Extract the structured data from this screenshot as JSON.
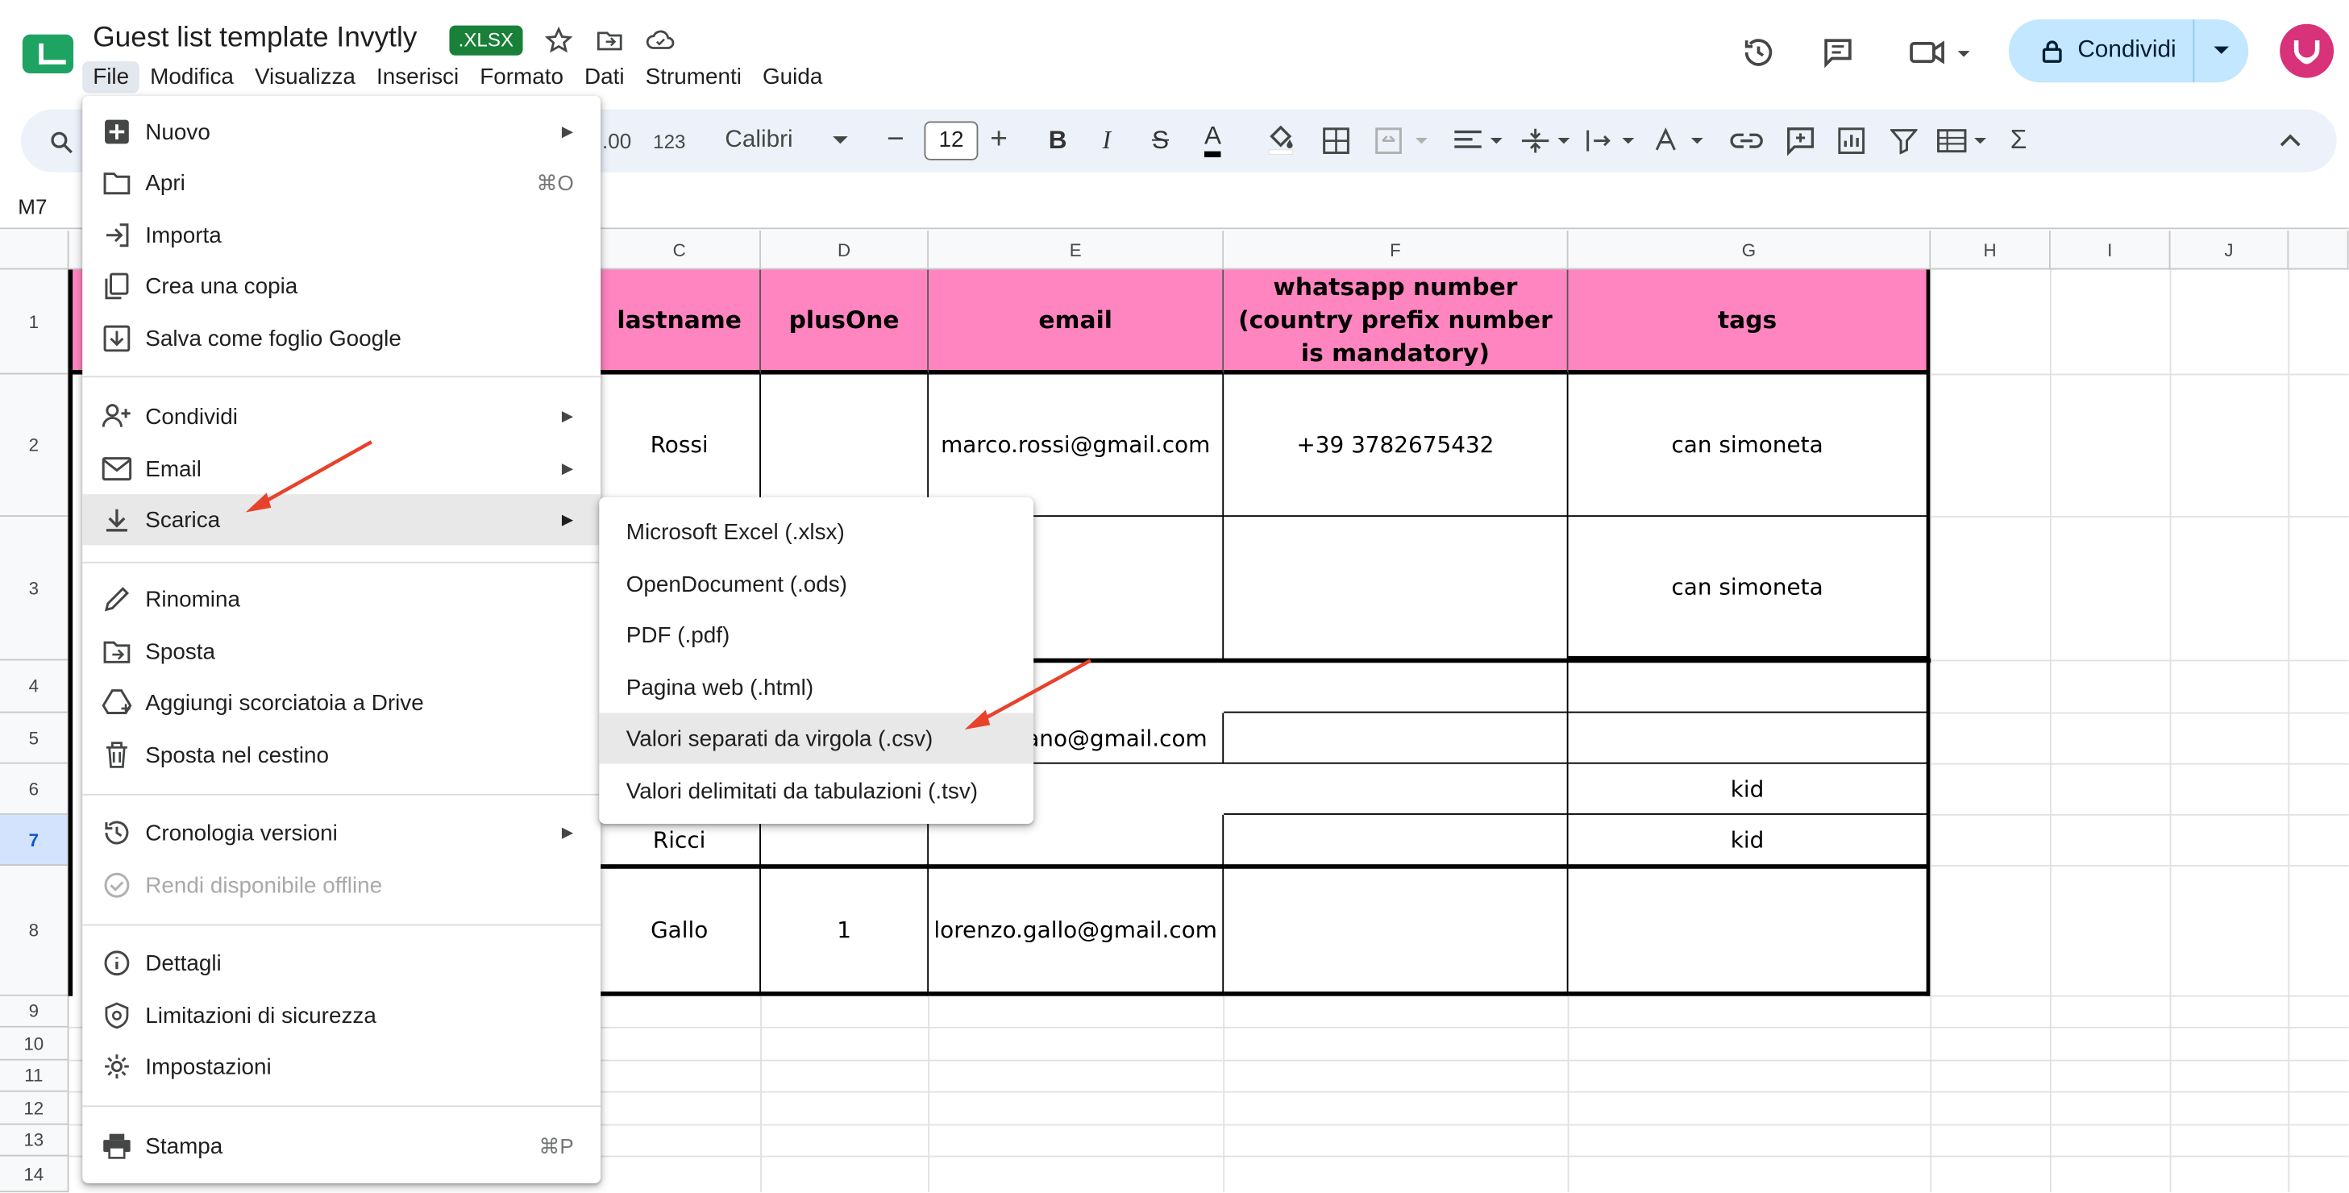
{
  "document": {
    "title": "Guest list template Invytly",
    "format_badge": ".XLSX"
  },
  "menubar": [
    "File",
    "Modifica",
    "Visualizza",
    "Inserisci",
    "Formato",
    "Dati",
    "Strumenti",
    "Guida"
  ],
  "share": {
    "label": "Condividi"
  },
  "toolbar": {
    "number_decimals": ".00",
    "number_format": "123",
    "font_family": "Calibri",
    "font_size": "12",
    "minus": "−",
    "plus": "+",
    "bold": "B",
    "italic": "I",
    "strike": "S",
    "text_color": "A",
    "sum": "Σ"
  },
  "name_box": "M7",
  "columns": [
    "C",
    "D",
    "E",
    "F",
    "G",
    "H",
    "I",
    "J"
  ],
  "rows": [
    "1",
    "2",
    "3",
    "4",
    "5",
    "6",
    "7",
    "8",
    "9",
    "10",
    "11",
    "12",
    "13",
    "14"
  ],
  "header_row": {
    "lastname": "lastname",
    "plusOne": "plusOne",
    "email": "email",
    "whatsapp": "whatsapp number (country prefix number is mandatory)",
    "tags": "tags"
  },
  "cells": {
    "r2_lastname": "Rossi",
    "r2_email": "marco.rossi@gmail.com",
    "r2_whatsapp": "+39 3782675432",
    "r2_tags": "can simoneta",
    "r3_tags": "can simoneta",
    "r5_email_partial": "nano@gmail.com",
    "r6_tags": "kid",
    "r7_lastname": "Ricci",
    "r7_tags": "kid",
    "r8_lastname": "Gallo",
    "r8_plusOne": "1",
    "r8_email": "lorenzo.gallo@gmail.com"
  },
  "file_menu": {
    "items": [
      {
        "label": "Nuovo",
        "icon": "plus-box-icon",
        "submenu": true
      },
      {
        "label": "Apri",
        "icon": "folder-icon",
        "shortcut": "⌘O"
      },
      {
        "label": "Importa",
        "icon": "import-icon"
      },
      {
        "label": "Crea una copia",
        "icon": "copy-icon"
      },
      {
        "label": "Salva come foglio Google",
        "icon": "save-sheet-icon"
      },
      {
        "label": "Condividi",
        "icon": "person-add-icon",
        "submenu": true
      },
      {
        "label": "Email",
        "icon": "mail-icon",
        "submenu": true
      },
      {
        "label": "Scarica",
        "icon": "download-icon",
        "submenu": true
      },
      {
        "label": "Rinomina",
        "icon": "pencil-icon"
      },
      {
        "label": "Sposta",
        "icon": "move-folder-icon"
      },
      {
        "label": "Aggiungi scorciatoia a Drive",
        "icon": "drive-shortcut-icon"
      },
      {
        "label": "Sposta nel cestino",
        "icon": "trash-icon"
      },
      {
        "label": "Cronologia versioni",
        "icon": "history-icon",
        "submenu": true
      },
      {
        "label": "Rendi disponibile offline",
        "icon": "offline-icon"
      },
      {
        "label": "Dettagli",
        "icon": "info-icon"
      },
      {
        "label": "Limitazioni di sicurezza",
        "icon": "security-icon"
      },
      {
        "label": "Impostazioni",
        "icon": "gear-icon"
      },
      {
        "label": "Stampa",
        "icon": "print-icon",
        "shortcut": "⌘P"
      }
    ]
  },
  "download_submenu": [
    "Microsoft Excel (.xlsx)",
    "OpenDocument (.ods)",
    "PDF (.pdf)",
    "Pagina web (.html)",
    "Valori separati da virgola (.csv)",
    "Valori delimitati da tabulazioni (.tsv)"
  ],
  "colors": {
    "accent": "#0b57d0",
    "header_fill": "#ff85c0",
    "share_bg": "#c2e7ff",
    "sheets_green": "#1ea362",
    "arrow": "#e8412c",
    "avatar": "#d7327a"
  }
}
